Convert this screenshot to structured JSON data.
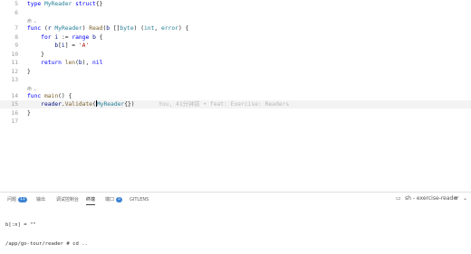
{
  "editor": {
    "lines": [
      {
        "n": "5",
        "segments": [
          {
            "t": "type ",
            "c": "kw"
          },
          {
            "t": "MyReader",
            "c": "ty"
          },
          {
            "t": " struct",
            "c": "kw"
          },
          {
            "t": "{}",
            "c": "pu"
          }
        ]
      },
      {
        "n": "6",
        "segments": []
      },
      {
        "lens": "命 ⌄"
      },
      {
        "n": "7",
        "segments": [
          {
            "t": "func ",
            "c": "kw"
          },
          {
            "t": "(",
            "c": "pu"
          },
          {
            "t": "r ",
            "c": "id"
          },
          {
            "t": "MyReader",
            "c": "ty"
          },
          {
            "t": ") ",
            "c": "pu"
          },
          {
            "t": "Read",
            "c": "fn"
          },
          {
            "t": "(",
            "c": "pu"
          },
          {
            "t": "b ",
            "c": "id"
          },
          {
            "t": "[]",
            "c": "pu"
          },
          {
            "t": "byte",
            "c": "ty"
          },
          {
            "t": ") (",
            "c": "pu"
          },
          {
            "t": "int",
            "c": "ty"
          },
          {
            "t": ", ",
            "c": "pu"
          },
          {
            "t": "error",
            "c": "ty"
          },
          {
            "t": ") {",
            "c": "pu"
          }
        ]
      },
      {
        "n": "8",
        "segments": [
          {
            "t": "    for ",
            "c": "kw"
          },
          {
            "t": "i ",
            "c": "id"
          },
          {
            "t": ":= ",
            "c": "pu"
          },
          {
            "t": "range ",
            "c": "kw"
          },
          {
            "t": "b",
            "c": "id"
          },
          {
            "t": " {",
            "c": "pu"
          }
        ]
      },
      {
        "n": "9",
        "segments": [
          {
            "t": "        b",
            "c": "id"
          },
          {
            "t": "[",
            "c": "pu"
          },
          {
            "t": "i",
            "c": "id"
          },
          {
            "t": "] = ",
            "c": "pu"
          },
          {
            "t": "'A'",
            "c": "st"
          }
        ]
      },
      {
        "n": "10",
        "segments": [
          {
            "t": "    }",
            "c": "pu"
          }
        ]
      },
      {
        "n": "11",
        "segments": [
          {
            "t": "    return ",
            "c": "kw"
          },
          {
            "t": "len",
            "c": "fn"
          },
          {
            "t": "(",
            "c": "pu"
          },
          {
            "t": "b",
            "c": "id"
          },
          {
            "t": "), ",
            "c": "pu"
          },
          {
            "t": "nil",
            "c": "kw"
          }
        ]
      },
      {
        "n": "12",
        "segments": [
          {
            "t": "}",
            "c": "pu"
          }
        ]
      },
      {
        "n": "13",
        "segments": []
      },
      {
        "lens": "命 ⌄"
      },
      {
        "n": "14",
        "segments": [
          {
            "t": "func ",
            "c": "kw"
          },
          {
            "t": "main",
            "c": "fn"
          },
          {
            "t": "() {",
            "c": "pu"
          }
        ]
      },
      {
        "n": "15",
        "current": true,
        "segments": [
          {
            "t": "    reader",
            "c": "id"
          },
          {
            "t": ".",
            "c": "pu"
          },
          {
            "t": "Validate",
            "c": "fn"
          },
          {
            "t": "(",
            "c": "pu"
          },
          {
            "t": "CURSOR",
            "c": "cursor"
          },
          {
            "t": "MyReader",
            "c": "ty"
          },
          {
            "t": "{})",
            "c": "pu"
          },
          {
            "t": "       You, 41分钟前 • feat: Exercise: Readers",
            "c": "ghost"
          }
        ]
      },
      {
        "n": "16",
        "segments": [
          {
            "t": "}",
            "c": "pu"
          }
        ]
      },
      {
        "n": "17",
        "segments": []
      }
    ]
  },
  "panel": {
    "tabs": [
      {
        "label": "问题",
        "badge": "11",
        "active": false
      },
      {
        "label": "输出",
        "badge": "",
        "active": false
      },
      {
        "label": "调试控制台",
        "badge": "",
        "active": false
      },
      {
        "label": "终端",
        "badge": "",
        "active": true
      },
      {
        "label": "端口",
        "badge": "5",
        "active": false
      },
      {
        "label": "GITLENS",
        "badge": "",
        "active": false
      }
    ],
    "terminal_name": "sh - exercise-reader",
    "terminal_lines": [
      "b[:n] = \"\"",
      "/app/go-tour/reader # cd .."
    ]
  }
}
